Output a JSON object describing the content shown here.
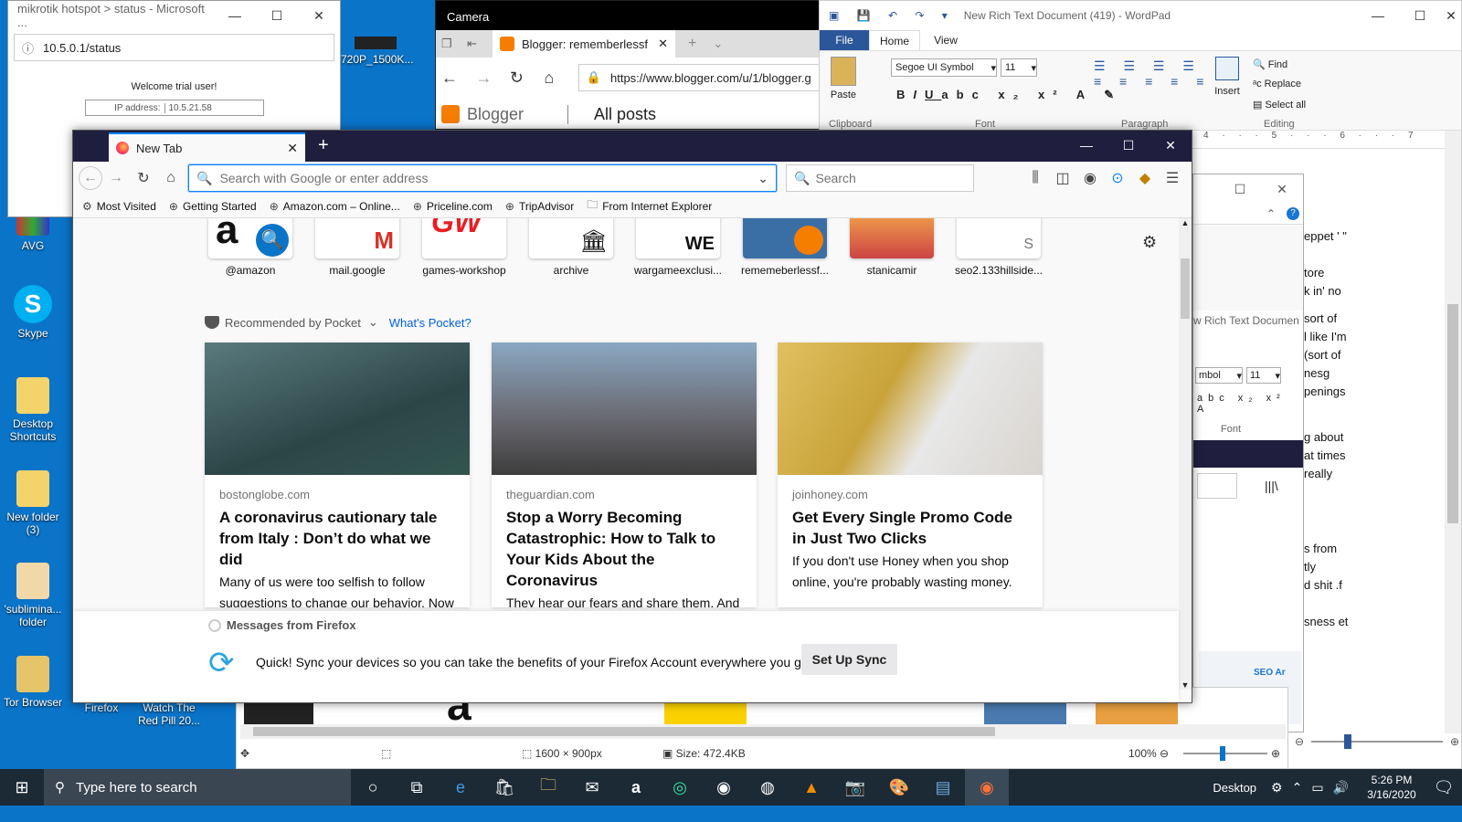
{
  "desktop": {
    "icons": [
      {
        "label": "AVG"
      },
      {
        "label": "Skype"
      },
      {
        "label": "Desktop Shortcuts"
      },
      {
        "label": "New folder (3)"
      },
      {
        "label": "'sublimina... folder"
      },
      {
        "label": "Tor Browser"
      },
      {
        "label": "Firefox"
      },
      {
        "label": "Watch The Red Pill 20..."
      },
      {
        "label": "720P_1500K..."
      }
    ]
  },
  "edge_window": {
    "title": "mikrotik hotspot > status - Microsoft ...",
    "url": "10.5.0.1/status",
    "welcome": "Welcome trial user!",
    "ip_label": "IP address:",
    "ip_value": "10.5.21.58"
  },
  "camera_window": {
    "title": "Camera",
    "tab_title": "Blogger: rememberlessf",
    "url": "https://www.blogger.com/u/1/blogger.g",
    "brand": "Blogger",
    "section": "All posts"
  },
  "wordpad": {
    "title": "New Rich Text Document (419) - WordPad",
    "tab_file": "File",
    "tab_home": "Home",
    "tab_view": "View",
    "font_name": "Segoe UI Symbol",
    "font_size": "11",
    "paste": "Paste",
    "clipboard": "Clipboard",
    "font_group": "Font",
    "paragraph": "Paragraph",
    "insert": "Insert",
    "find": "Find",
    "replace": "Replace",
    "select_all": "Select all",
    "editing": "Editing",
    "doc_fragments": [
      "eppet ' \"",
      "tore",
      "k in' no",
      "sort of",
      "l like I'm",
      "(sort of",
      "nesg",
      "penings",
      "g about",
      "at times",
      "really",
      "s from",
      "tly",
      "d shit .f",
      "sness et"
    ]
  },
  "behind_window": {
    "doc_title": "w Rich Text Documen",
    "font_name": "mbol",
    "font_size": "11",
    "font_group": "Font",
    "thumb_text": "SEO Ar"
  },
  "firefox": {
    "tab_title": "New Tab",
    "search_placeholder": "Search with Google or enter address",
    "search_box_placeholder": "Search",
    "bookmarks": [
      "Most Visited",
      "Getting Started",
      "Amazon.com – Online...",
      "Priceline.com",
      "TripAdvisor",
      "From Internet Explorer"
    ],
    "top_sites": [
      "@amazon",
      "mail.google",
      "games-workshop",
      "archive",
      "wargameexclusi...",
      "rememeberlessf...",
      "stanicamir",
      "seo2.133hillside..."
    ],
    "pocket_label": "Recommended by Pocket",
    "whats_pocket": "What's Pocket?",
    "stories": [
      {
        "source": "bostonglobe.com",
        "title": "A coronavirus cautionary tale from Italy : Don’t do what we did",
        "excerpt": "Many of us were too selfish to follow suggestions to change our behavior. Now we’re in lockdown and people ar..."
      },
      {
        "source": "theguardian.com",
        "title": "Stop a Worry Becoming Catastrophic: How to Talk to Your Kids About the Coronavirus",
        "excerpt": "They hear our fears and share them. And they need our help to work it all"
      },
      {
        "source": "joinhoney.com",
        "title": "Get Every Single Promo Code in Just Two Clicks",
        "excerpt": "If you don't use Honey when you shop online, you're probably wasting money."
      }
    ],
    "messages_label": "Messages from Firefox",
    "sync_message": "Quick! Sync your devices so you can take the benefits of your Firefox Account everywhere you go.",
    "sync_button": "Set Up Sync"
  },
  "image_viewer": {
    "dimensions": "1600 × 900px",
    "size": "Size: 472.4KB",
    "zoom": "100%"
  },
  "taskbar": {
    "search_placeholder": "Type here to search",
    "desktop_label": "Desktop",
    "time": "5:26 PM",
    "date": "3/16/2020"
  }
}
